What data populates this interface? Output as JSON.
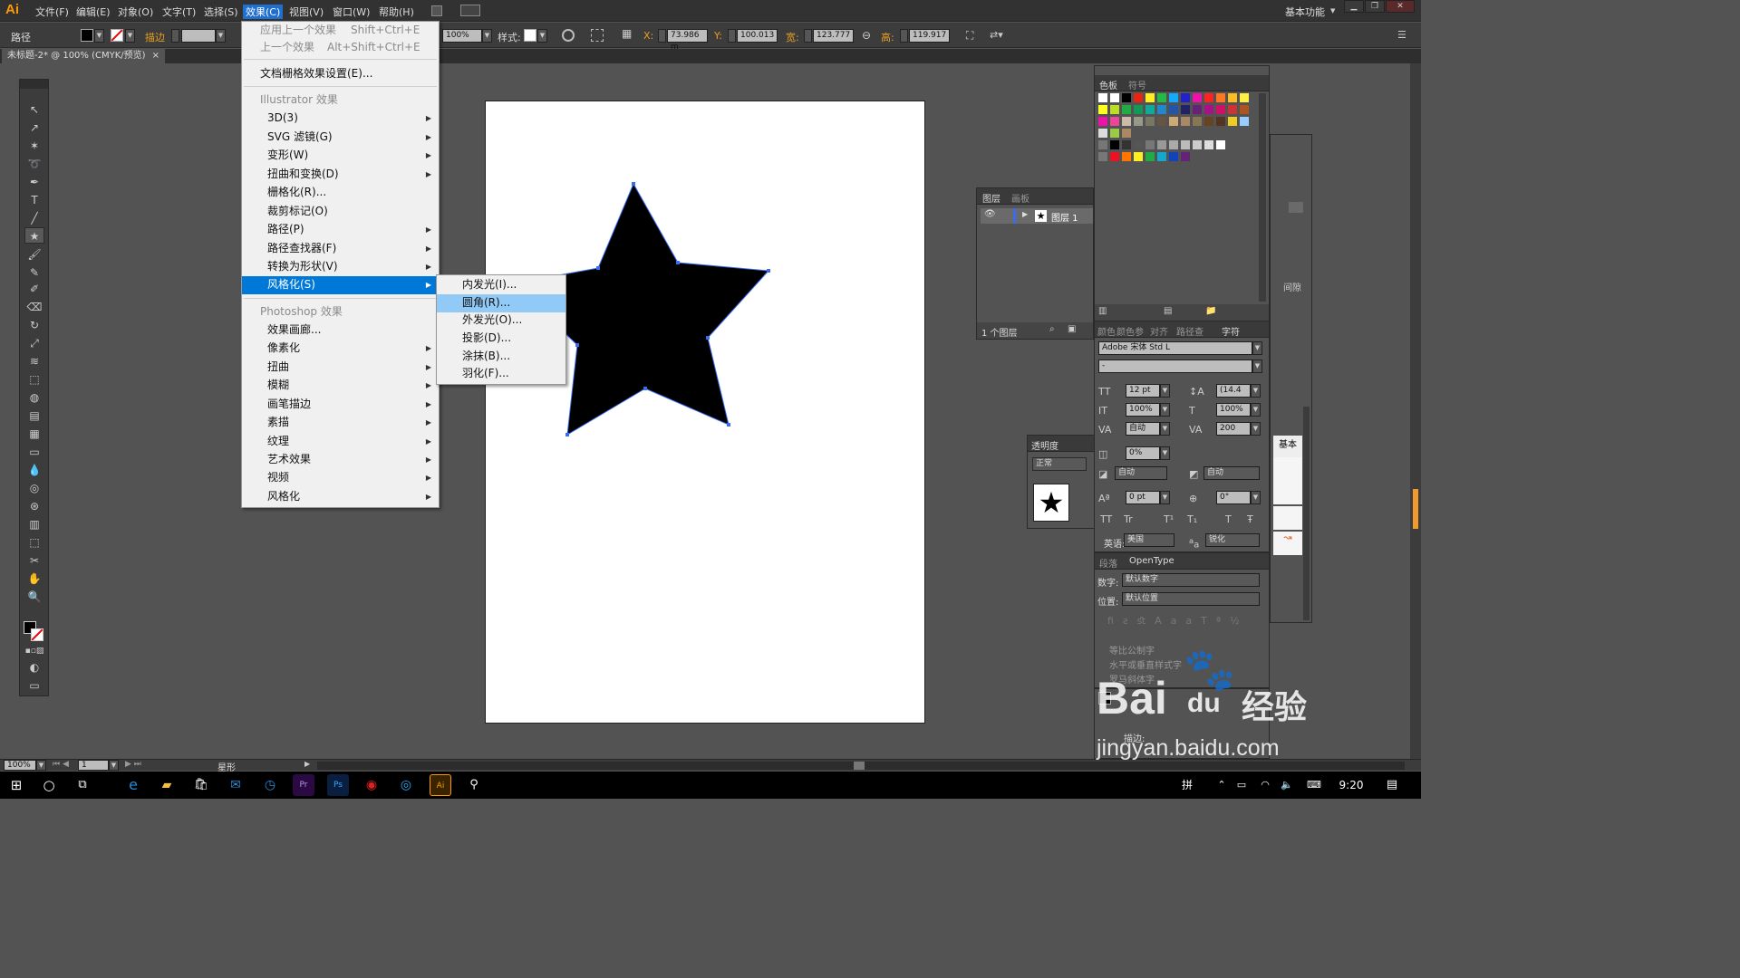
{
  "app": {
    "logo": "Ai",
    "workspace": "基本功能"
  },
  "menubar": [
    "文件(F)",
    "编辑(E)",
    "对象(O)",
    "文字(T)",
    "选择(S)",
    "效果(C)",
    "视图(V)",
    "窗口(W)",
    "帮助(H)"
  ],
  "control_bar": {
    "label": "路径",
    "stroke_label": "描边",
    "opacity": "100%",
    "style_label": "样式:",
    "x_label": "X:",
    "x": "73.986 m",
    "y_label": "Y:",
    "y": "100.013",
    "w_label": "宽:",
    "w": "123.777",
    "h_label": "高:",
    "h": "119.917"
  },
  "doc_tab": {
    "title": "未标题-2* @ 100% (CMYK/预览)",
    "close": "×"
  },
  "effect_menu": {
    "apply_last": "应用上一个效果",
    "apply_last_shortcut": "Shift+Ctrl+E",
    "last_effect": "上一个效果",
    "last_effect_shortcut": "Alt+Shift+Ctrl+E",
    "raster_settings": "文档栅格效果设置(E)...",
    "illustrator_header": "Illustrator 效果",
    "illustrator_items": [
      "3D(3)",
      "SVG 滤镜(G)",
      "变形(W)",
      "扭曲和变换(D)",
      "栅格化(R)...",
      "裁剪标记(O)",
      "路径(P)",
      "路径查找器(F)",
      "转换为形状(V)",
      "风格化(S)"
    ],
    "photoshop_header": "Photoshop 效果",
    "photoshop_items": [
      "效果画廊...",
      "像素化",
      "扭曲",
      "模糊",
      "画笔描边",
      "素描",
      "纹理",
      "艺术效果",
      "视频",
      "风格化"
    ]
  },
  "stylize_submenu": [
    "内发光(I)...",
    "圆角(R)...",
    "外发光(O)...",
    "投影(D)...",
    "涂抹(B)...",
    "羽化(F)..."
  ],
  "swatches_panel": {
    "tabs": [
      "色板",
      "符号"
    ]
  },
  "layers_panel": {
    "tabs": [
      "图层",
      "画板"
    ],
    "layer_name": "图层 1",
    "footer": "1 个图层"
  },
  "transparency_panel": {
    "title": "透明度",
    "mode": "正常"
  },
  "character_panel": {
    "tabs": [
      "颜色",
      "颜色参",
      "对齐",
      "路径查",
      "字符"
    ],
    "font": "Adobe 宋体 Std L",
    "style": "-",
    "size": "12 pt",
    "leading": "(14.4",
    "hscale": "100%",
    "vscale": "100%",
    "kerning": "自动",
    "tracking": "200",
    "tsume": "0%",
    "aki1": "自动",
    "aki2": "自动",
    "baseline": "0 pt",
    "rotate": "0°",
    "lang_label": "英语:",
    "lang": "美国",
    "aa_label": "a",
    "aa": "锐化",
    "caps": [
      "TT",
      "Tr",
      "T¹",
      "T₁",
      "T",
      "Ŧ"
    ]
  },
  "opentype_panel": {
    "tabs": [
      "段落",
      "OpenType"
    ],
    "figure_label": "数字:",
    "figure": "默认数字",
    "position_label": "位置:",
    "position": "默认位置",
    "options": [
      "等比公制字",
      "水平或垂直样式字",
      "罗马斜体字"
    ]
  },
  "right_panel": {
    "label": "基本",
    "label2": "间隙"
  },
  "status": {
    "zoom": "100%",
    "page": "1",
    "tool": "星形"
  },
  "stroke_mini": {
    "label": "描边:"
  },
  "taskbar": {
    "ime": "拼",
    "time": "9:20"
  },
  "watermark": {
    "brand": "Bai",
    "paw": "du",
    "jy": "经验",
    "url": "jingyan.baidu.com"
  }
}
